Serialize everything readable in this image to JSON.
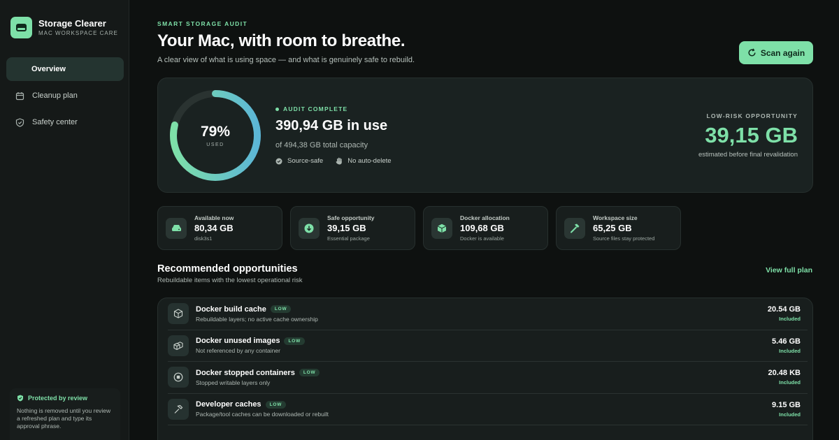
{
  "sidebar": {
    "brand_title": "Storage Clearer",
    "brand_subtitle": "MAC WORKSPACE CARE",
    "items": [
      {
        "label": "Overview",
        "icon": "none",
        "active": true
      },
      {
        "label": "Cleanup plan",
        "icon": "calendar-icon"
      },
      {
        "label": "Safety center",
        "icon": "shield-icon"
      }
    ],
    "protect_title": "Protected by review",
    "protect_body": "Nothing is removed until you review a refreshed plan and type its approval phrase."
  },
  "header": {
    "eyebrow": "SMART STORAGE AUDIT",
    "title": "Your Mac, with room to breathe.",
    "subtitle": "A clear view of what is using space — and what is genuinely safe to rebuild.",
    "scan_label": "Scan again"
  },
  "hero": {
    "used_pct_label": "79%",
    "used_fraction": 0.79,
    "used_caption": "USED",
    "status": "AUDIT COMPLETE",
    "in_use": "390,94 GB in use",
    "capacity": "of 494,38 GB total capacity",
    "tag1": "Source-safe",
    "tag2": "No auto-delete",
    "opp_label": "LOW-RISK OPPORTUNITY",
    "opp_value": "39,15 GB",
    "opp_note": "estimated before final revalidation"
  },
  "stats": [
    {
      "label": "Available now",
      "value": "80,34 GB",
      "sub": "disk3s1",
      "icon": "drive-icon"
    },
    {
      "label": "Safe opportunity",
      "value": "39,15 GB",
      "sub": "Essential package",
      "icon": "download-icon"
    },
    {
      "label": "Docker allocation",
      "value": "109,68 GB",
      "sub": "Docker is available",
      "icon": "cube-icon"
    },
    {
      "label": "Workspace size",
      "value": "65,25 GB",
      "sub": "Source files stay protected",
      "icon": "hammer-icon"
    }
  ],
  "opportunities": {
    "title": "Recommended opportunities",
    "subtitle": "Rebuildable items with the lowest operational risk",
    "view_plan": "View full plan",
    "rows": [
      {
        "title": "Docker build cache",
        "badge": "LOW",
        "desc": "Rebuildable layers; no active cache ownership",
        "size": "20.54 GB",
        "status": "Included",
        "icon": "box-icon"
      },
      {
        "title": "Docker unused images",
        "badge": "LOW",
        "desc": "Not referenced by any container",
        "size": "5.46 GB",
        "status": "Included",
        "icon": "boxes-icon"
      },
      {
        "title": "Docker stopped containers",
        "badge": "LOW",
        "desc": "Stopped writable layers only",
        "size": "20.48 KB",
        "status": "Included",
        "icon": "stop-icon"
      },
      {
        "title": "Developer caches",
        "badge": "LOW",
        "desc": "Package/tool caches can be downloaded or rebuilt",
        "size": "9.15 GB",
        "status": "Included",
        "icon": "hammer-icon"
      }
    ]
  },
  "colors": {
    "accent": "#7ee0a8",
    "background": "#0e1110",
    "panel": "#1a2221"
  }
}
